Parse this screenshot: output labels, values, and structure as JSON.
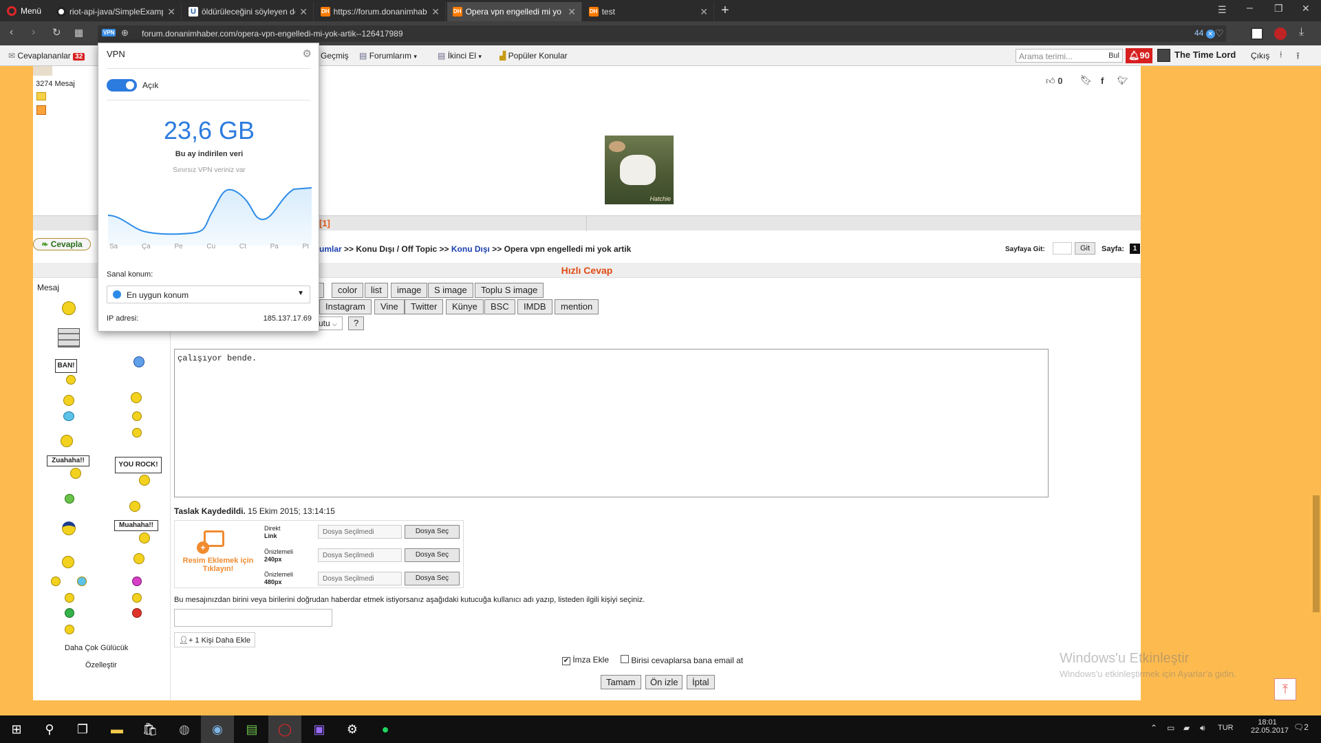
{
  "browser": {
    "menu_label": "Menü",
    "tabs": [
      {
        "title": "riot-api-java/SimpleExamp",
        "icon": "github-icon"
      },
      {
        "title": "öldürüleceğini söyleyen de",
        "icon": "uludag-icon"
      },
      {
        "title": "https://forum.donanimhab",
        "icon": "dh-icon"
      },
      {
        "title": "Opera vpn engelledi mi yo",
        "icon": "dh-icon",
        "active": true
      },
      {
        "title": "test",
        "icon": "dh-icon"
      }
    ],
    "vpn_badge": "VPN",
    "url": "forum.donanimhaber.com/opera-vpn-engelledi-mi-yok-artik--126417989",
    "blocked_count": "44"
  },
  "bookmarks": {
    "cevaplananlar": "Cevaplananlar",
    "cevaplananlar_count": "32",
    "gecmis": "Geçmiş",
    "forumlarim": "Forumlarım",
    "ikinci_el": "İkinci El",
    "populer": "Popüler Konular",
    "search_placeholder": "Arama terimi...",
    "search_button": "Bul",
    "notif_count": "90",
    "username": "The Time Lord",
    "logout": "Çıkış"
  },
  "vpn_popup": {
    "title": "VPN",
    "toggle_label": "Açık",
    "data_amount": "23,6 GB",
    "data_caption": "Bu ay indirilen veri",
    "unlimited_note": "Sınırsız VPN veriniz var",
    "days": [
      "Sa",
      "Ça",
      "Pe",
      "Cu",
      "Ct",
      "Pa",
      "Pt"
    ],
    "location_label": "Sanal konum:",
    "location_value": "En uygun konum",
    "ip_label": "IP adresi:",
    "ip_value": "185.137.17.69"
  },
  "post": {
    "message_count": "3274 Mesaj",
    "likes": "0",
    "image_caption": "Hatchie"
  },
  "paging": {
    "page_ref": "[1]"
  },
  "breadcrumb": {
    "reply_button": "Cevapla",
    "part1": "umlar",
    "sep1": ">>",
    "part2": "Konu Dışı / Off Topic",
    "sep2": ">>",
    "part3": "Konu Dışı",
    "sep3": ">>",
    "part4": "Opera vpn engelledi mi yok artik",
    "goto_label": "Sayfaya Git:",
    "goto_button": "Git",
    "page_label": "Sayfa:",
    "page_number": "1"
  },
  "quick_reply": {
    "title": "Hızlı Cevap",
    "message_label": "Mesaj",
    "toolbar_row1": [
      "k",
      "color",
      "list",
      "image",
      "S image",
      "Toplu S image"
    ],
    "toolbar_row2": [
      "Instagram",
      "Vine",
      "Twitter",
      "Künye",
      "BSC",
      "IMDB",
      "mention"
    ],
    "select_value": "utu",
    "help_button": "?",
    "message_text": "çalışıyor bende.",
    "draft_saved": "Taslak Kaydedildi.",
    "draft_time": "15 Ekim 2015; 13:14:15",
    "upload_cta": "Resim Eklemek için Tıklayın!",
    "upload_rows": [
      {
        "label_top": "Direkt",
        "label_bottom": "Link",
        "file": "Dosya Seçilmedi",
        "button": "Dosya Seç"
      },
      {
        "label_top": "Önizlemeli",
        "label_bottom": "240px",
        "file": "Dosya Seçilmedi",
        "button": "Dosya Seç"
      },
      {
        "label_top": "Önizlemeli",
        "label_bottom": "480px",
        "file": "Dosya Seçilmedi",
        "button": "Dosya Seç"
      }
    ],
    "mention_note": "Bu mesajınızdan birini veya birilerini doğrudan haberdar etmek istiyorsanız aşağıdaki kutucuğa kullanıcı adı yazıp, listeden ilgili kişiyi seçiniz.",
    "add_person": "1 Kişi Daha Ekle",
    "signature_label": "İmza Ekle",
    "email_label": "Birisi cevaplarsa bana email at",
    "submit": "Tamam",
    "preview": "Ön izle",
    "cancel": "İptal",
    "more_smileys": "Daha Çok Gülücük",
    "customize": "Özelleştir",
    "smiley_signs": [
      "BAN!",
      "Zuahaha!!",
      "YOU ROCK!",
      "Muahaha!!"
    ]
  },
  "watermark": {
    "line1": "Windows'u Etkinleştir",
    "line2": "Windows'u etkinleştirmek için Ayarlar'a gidin."
  },
  "taskbar": {
    "language": "TUR",
    "time": "18:01",
    "date": "22.05.2017",
    "notification_count": "2"
  }
}
